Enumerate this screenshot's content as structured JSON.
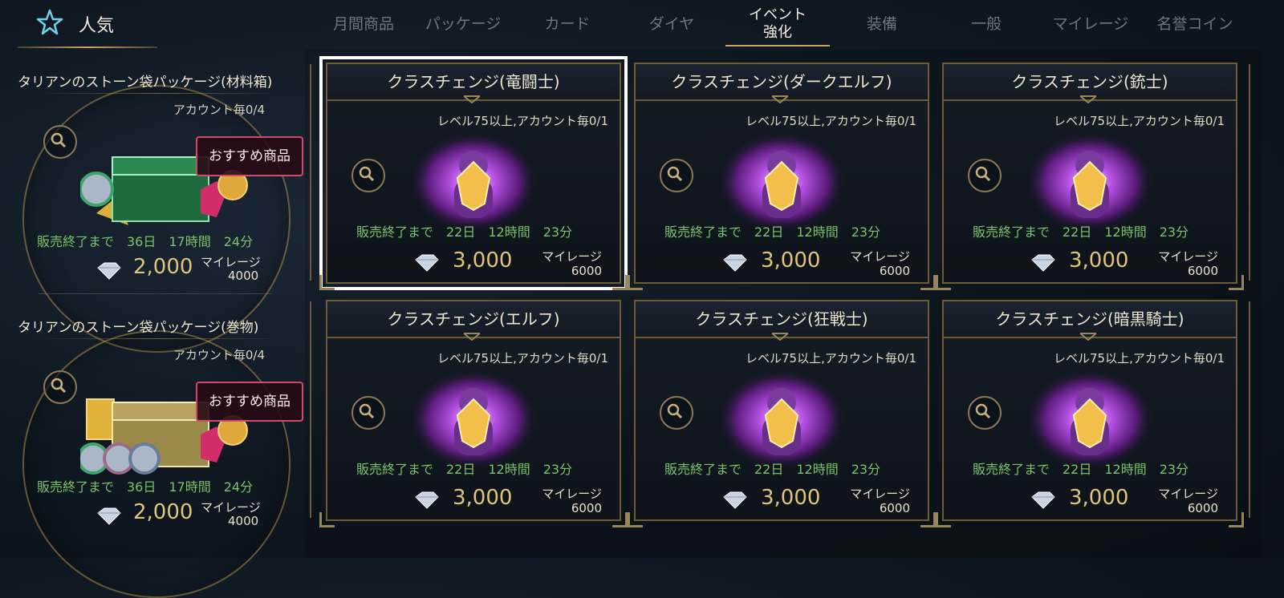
{
  "popular": {
    "label": "人気"
  },
  "tabs": [
    {
      "label": "月間商品"
    },
    {
      "label": "パッケージ"
    },
    {
      "label": "カード"
    },
    {
      "label": "ダイヤ"
    },
    {
      "label_line1": "イベント",
      "label_line2": "強化",
      "active": true
    },
    {
      "label": "装備"
    },
    {
      "label": "一般"
    },
    {
      "label": "マイレージ"
    },
    {
      "label": "名誉コイン"
    }
  ],
  "features": [
    {
      "title": "タリアンのストーン袋パッケージ(材料箱)",
      "limit": "アカウント毎0/4",
      "badge": "おすすめ商品",
      "timer": "販売終了まで　36日　17時間　24分",
      "price": "2,000",
      "mileage_label": "マイレージ",
      "mileage_value": "4000"
    },
    {
      "title": "タリアンのストーン袋パッケージ(巻物)",
      "limit": "アカウント毎0/4",
      "badge": "おすすめ商品",
      "timer": "販売終了まで　36日　17時間　24分",
      "price": "2,000",
      "mileage_label": "マイレージ",
      "mileage_value": "4000"
    }
  ],
  "cards": [
    {
      "title": "クラスチェンジ(竜闘士)",
      "requirement": "レベル75以上,アカウント毎0/1",
      "timer": "販売終了まで　22日　12時間　23分",
      "price": "3,000",
      "mileage_label": "マイレージ",
      "mileage_value": "6000",
      "selected": true
    },
    {
      "title": "クラスチェンジ(ダークエルフ)",
      "requirement": "レベル75以上,アカウント毎0/1",
      "timer": "販売終了まで　22日　12時間　23分",
      "price": "3,000",
      "mileage_label": "マイレージ",
      "mileage_value": "6000"
    },
    {
      "title": "クラスチェンジ(銃士)",
      "requirement": "レベル75以上,アカウント毎0/1",
      "timer": "販売終了まで　22日　12時間　23分",
      "price": "3,000",
      "mileage_label": "マイレージ",
      "mileage_value": "6000"
    },
    {
      "title": "クラスチェンジ(エルフ)",
      "requirement": "レベル75以上,アカウント毎0/1",
      "timer": "販売終了まで　22日　12時間　23分",
      "price": "3,000",
      "mileage_label": "マイレージ",
      "mileage_value": "6000"
    },
    {
      "title": "クラスチェンジ(狂戦士)",
      "requirement": "レベル75以上,アカウント毎0/1",
      "timer": "販売終了まで　22日　12時間　23分",
      "price": "3,000",
      "mileage_label": "マイレージ",
      "mileage_value": "6000"
    },
    {
      "title": "クラスチェンジ(暗黒騎士)",
      "requirement": "レベル75以上,アカウント毎0/1",
      "timer": "販売終了まで　22日　12時間　23分",
      "price": "3,000",
      "mileage_label": "マイレージ",
      "mileage_value": "6000"
    }
  ],
  "colors": {
    "accent_gold": "#c9a65f",
    "timer_green": "#79c46a",
    "price_gold": "#e1c37a",
    "badge_pink": "#d04a6c"
  }
}
